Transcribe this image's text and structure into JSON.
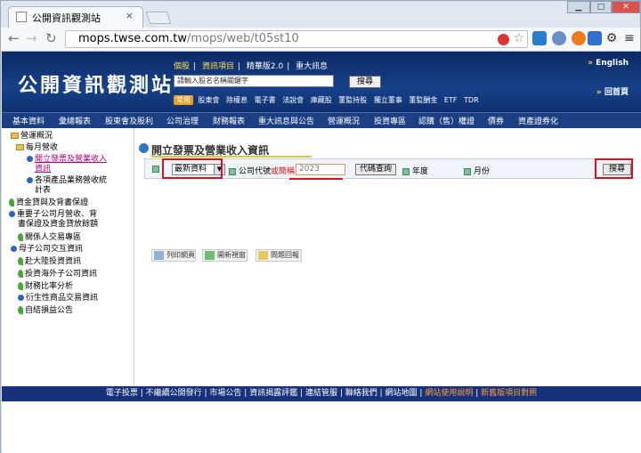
{
  "browser": {
    "tab_title": "公開資訊觀測站",
    "close_glyph": "×",
    "url_domain": "mops.twse.com.tw",
    "url_path": "/mops/web/t05st10"
  },
  "header": {
    "logo": "公開資訊觀測站",
    "top_links": [
      "個股",
      "資訊項目",
      "精華版2.0",
      "重大訊息"
    ],
    "search_placeholder": "請輸入股名名稱關鍵字",
    "search_button": "搜尋",
    "common_badge": "常用",
    "common_links": [
      "股東會",
      "除權息",
      "電子書",
      "法說會",
      "庫藏股",
      "董監持股",
      "獨立董事",
      "董監酬金",
      "ETF",
      "TDR"
    ],
    "english": "English",
    "home": "回首頁"
  },
  "menu": {
    "items": [
      "基本資料",
      "彙總報表",
      "股東會及股利",
      "公司治理",
      "財務報表",
      "重大訊息與公告",
      "營運概況",
      "投資專區",
      "認購（售）權證",
      "債券",
      "資產證券化"
    ]
  },
  "sidebar": {
    "root": "營運概況",
    "items": [
      "每月營收",
      "開立發票及營業收入",
      "資訊",
      "各項產品業務營收統",
      "計表",
      "資金貸與及背書保證",
      "重要子公司月營收、背",
      "書保證及資金貸放餘額",
      "關係人交易專區",
      "母子公司交互資訊",
      "赴大陸投資資訊",
      "投資海外子公司資訊",
      "財務比率分析",
      "衍生性商品交易資訊",
      "自結損益公告"
    ]
  },
  "main": {
    "title": "開立發票及營業收入資訊",
    "select_value": "最新資料",
    "company_label": "公司代號",
    "company_label_red": "或簡稱",
    "year_value": "2023",
    "code_query_button": "代碼查詢",
    "year_label": "年度",
    "month_label": "月份",
    "search_button": "搜尋",
    "tools": [
      "列印網頁",
      "開新視窗",
      "問題回報"
    ]
  },
  "footer": {
    "links": [
      "電子投票",
      "不繼續公開發行",
      "市場公告",
      "資訊揭露評鑑",
      "連結管服",
      "聯絡我們",
      "網站地圖"
    ],
    "orange_links": [
      "網站使用說明",
      "新舊版項目對照"
    ]
  }
}
